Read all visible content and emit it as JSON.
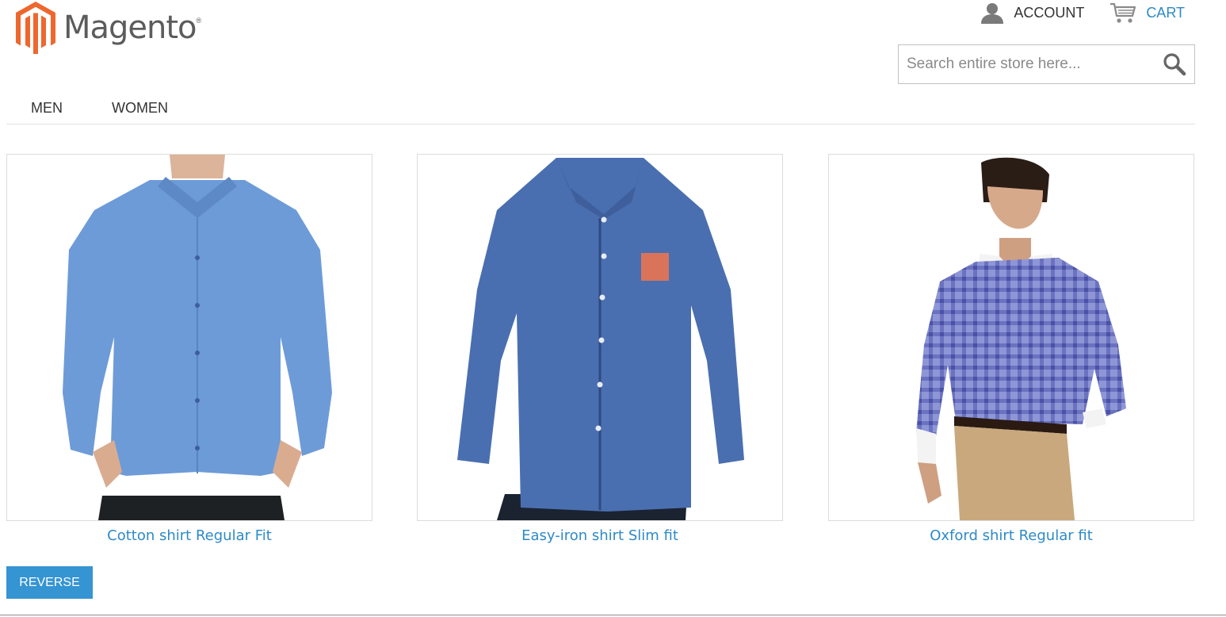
{
  "brand": {
    "name": "Magento",
    "registered_mark": "®",
    "accent_color": "#ee672f"
  },
  "header": {
    "account_label": "ACCOUNT",
    "cart_label": "CART",
    "account_icon": "user-icon",
    "cart_icon": "cart-icon"
  },
  "search": {
    "placeholder": "Search entire store here...",
    "value": "",
    "icon": "search-icon"
  },
  "nav": {
    "items": [
      {
        "label": "MEN"
      },
      {
        "label": "WOMEN"
      }
    ]
  },
  "products": [
    {
      "name": "Cotton shirt Regular Fit",
      "shirt_color": "#6d9bd8"
    },
    {
      "name": "Easy-iron shirt Slim fit",
      "shirt_color": "#4a6fb0"
    },
    {
      "name": "Oxford shirt Regular fit",
      "shirt_color": "#7d84c9"
    }
  ],
  "actions": {
    "reverse_label": "REVERSE"
  },
  "colors": {
    "link": "#2d8ac7",
    "button": "#3594d2",
    "text": "#333333"
  }
}
